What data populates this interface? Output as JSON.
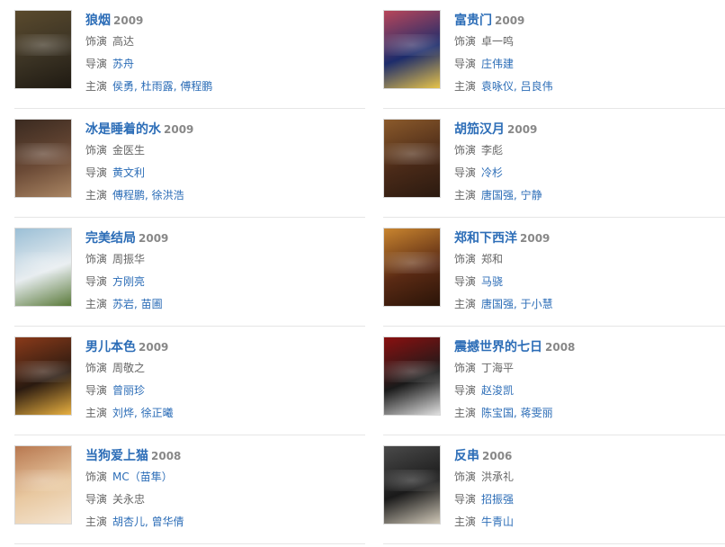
{
  "labels": {
    "role": "饰演",
    "director": "导演",
    "cast": "主演"
  },
  "items": [
    {
      "title": "狼烟",
      "year": "2009",
      "role": "高达",
      "director": "苏舟",
      "cast": [
        "侯勇",
        "杜雨露",
        "傅程鹏"
      ],
      "poster_colors": [
        "#3b3324",
        "#5a4a2d",
        "#1f1a12"
      ]
    },
    {
      "title": "富贵门",
      "year": "2009",
      "role": "卓一鸣",
      "director": "庄伟建",
      "cast": [
        "袁咏仪",
        "吕良伟"
      ],
      "poster_colors": [
        "#1d2c6b",
        "#b8465a",
        "#e6c34a"
      ]
    },
    {
      "title": "冰是睡着的水",
      "year": "2009",
      "role": "金医生",
      "director": "黄文利",
      "cast": [
        "傅程鹏",
        "徐洪浩"
      ],
      "poster_colors": [
        "#6b4a36",
        "#3a2a20",
        "#a98563"
      ]
    },
    {
      "title": "胡笳汉月",
      "year": "2009",
      "role": "李彪",
      "director": "冷杉",
      "cast": [
        "唐国强",
        "宁静"
      ],
      "poster_colors": [
        "#4a2a18",
        "#8b5a2b",
        "#2b1a10"
      ]
    },
    {
      "title": "完美结局",
      "year": "2009",
      "role": "周振华",
      "director": "方刚亮",
      "cast": [
        "苏岩",
        "苗圃"
      ],
      "poster_colors": [
        "#e8edf0",
        "#9bbfd6",
        "#5a7a3a"
      ]
    },
    {
      "title": "郑和下西洋",
      "year": "2009",
      "role": "郑和",
      "director": "马骁",
      "cast": [
        "唐国强",
        "于小慧"
      ],
      "poster_colors": [
        "#5a2a14",
        "#c9852f",
        "#2a1408"
      ]
    },
    {
      "title": "男儿本色",
      "year": "2009",
      "role": "周敬之",
      "director": "曾丽珍",
      "cast": [
        "刘烨",
        "徐正曦"
      ],
      "poster_colors": [
        "#2a1a10",
        "#8a3a1a",
        "#e8b040"
      ]
    },
    {
      "title": "震撼世界的七日",
      "year": "2008",
      "role": "丁海平",
      "director": "赵浚凯",
      "cast": [
        "陈宝国",
        "蒋雯丽"
      ],
      "poster_colors": [
        "#1a1a1a",
        "#8a1010",
        "#e0e0e0"
      ]
    },
    {
      "title": "当狗爱上猫",
      "year": "2008",
      "role": "MC（苗隼）",
      "director": "关永忠",
      "cast": [
        "胡杏儿",
        "曾华倩"
      ],
      "poster_colors": [
        "#e8c8a0",
        "#b87850",
        "#f4e4d0"
      ]
    },
    {
      "title": "反串",
      "year": "2006",
      "role": "洪承礼",
      "director": "招振强",
      "cast": [
        "牛青山"
      ],
      "poster_colors": [
        "#1a1a1a",
        "#4a4a4a",
        "#d0c8b8"
      ]
    }
  ]
}
